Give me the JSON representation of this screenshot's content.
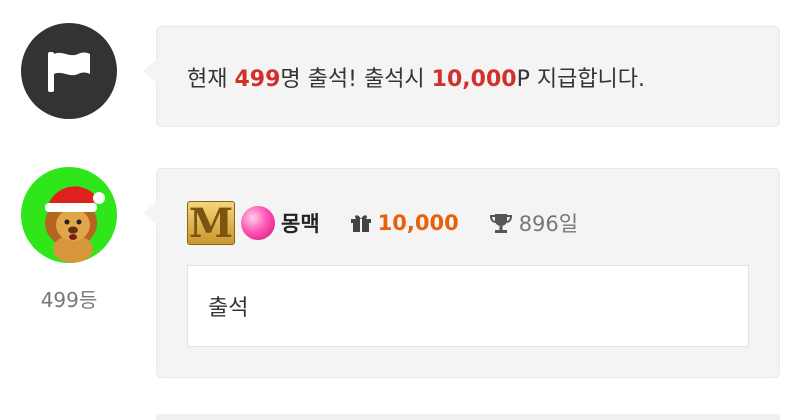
{
  "notice": {
    "icon": "flag-icon",
    "text_before": "현재 ",
    "count": "499",
    "text_mid": "명 출석! 출석시 ",
    "reward": "10,000",
    "text_after": "P 지급합니다."
  },
  "comment": {
    "rank_label": "499등",
    "avatar_icon": "lion-santa-avatar",
    "level_badge": "M",
    "candy_icon": "candy-icon",
    "nickname": "몽맥",
    "gift_icon": "gift-icon",
    "points": "10,000",
    "trophy_icon": "trophy-icon",
    "days": "896일",
    "text": "출석"
  },
  "colors": {
    "highlight_red": "#d0312d",
    "points_orange": "#e8600a",
    "avatar_green": "#2ee61a",
    "bubble_bg": "#f4f4f4"
  }
}
